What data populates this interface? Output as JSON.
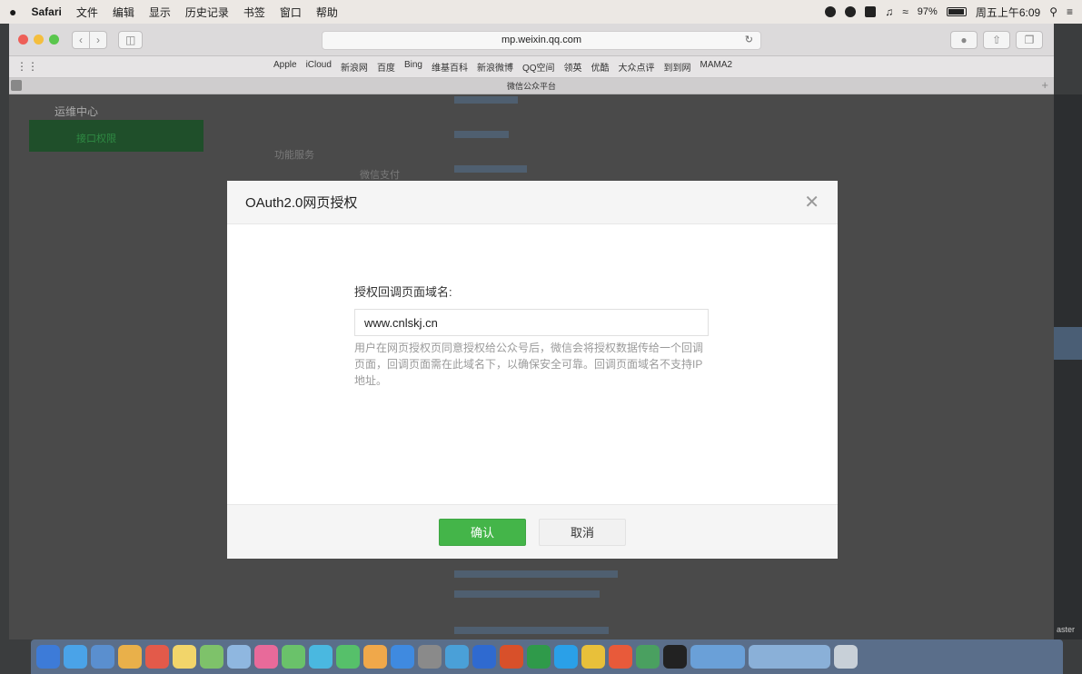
{
  "menubar": {
    "app": "Safari",
    "items": [
      "文件",
      "编辑",
      "显示",
      "历史记录",
      "书签",
      "窗口",
      "帮助"
    ],
    "battery": "97%",
    "clock": "周五上午6:09"
  },
  "browser": {
    "url": "mp.weixin.qq.com",
    "tab_title": "微信公众平台",
    "favorites": [
      "Apple",
      "iCloud",
      "新浪网",
      "百度",
      "Bing",
      "维基百科",
      "新浪微博",
      "QQ空间",
      "领英",
      "优酷",
      "大众点评",
      "到到网",
      "MAMA2"
    ]
  },
  "background_page": {
    "sidebar_item": "运维中心",
    "sidebar_active": "接口权限",
    "section_label": "功能服务",
    "row_label": "微信支付",
    "right_edge_text": "aster"
  },
  "modal": {
    "title": "OAuth2.0网页授权",
    "field_label": "授权回调页面域名:",
    "field_value": "www.cnlskj.cn",
    "help_text": "用户在网页授权页同意授权给公众号后，微信会将授权数据传给一个回调页面，回调页面需在此域名下，以确保安全可靠。回调页面域名不支持IP地址。",
    "confirm_label": "确认",
    "cancel_label": "取消"
  },
  "colors": {
    "primary_green": "#44b549",
    "dim_overlay": "#4a4a4a"
  }
}
